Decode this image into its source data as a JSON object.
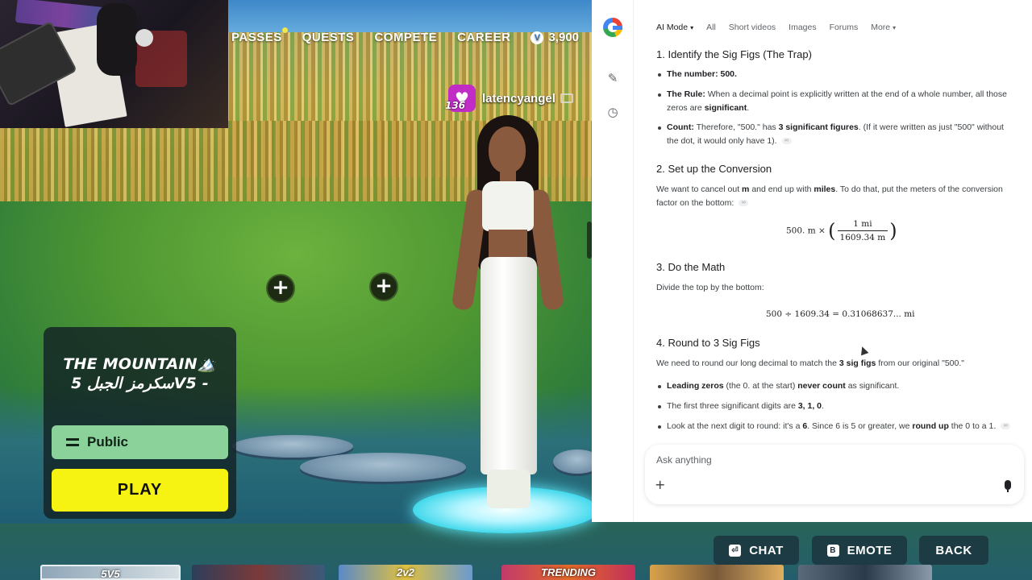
{
  "game": {
    "nav": [
      {
        "label": "PASSES",
        "dot": true
      },
      {
        "label": "QUESTS"
      },
      {
        "label": "COMPETE"
      },
      {
        "label": "CAREER"
      }
    ],
    "vbucks": "3,900",
    "vbucks_icon": "vbucks-icon",
    "player": {
      "level": "136",
      "name": "latencyangel"
    },
    "mode": {
      "title_line1": "THE MOUNTAIN🏔️",
      "title_line2": "سكرمز الجبل 5V5 -",
      "privacy": "Public",
      "play": "PLAY"
    },
    "bottom_buttons": {
      "chat_key": "⏎",
      "chat": "CHAT",
      "emote_key": "B",
      "emote": "EMOTE",
      "back": "BACK"
    },
    "tiles": [
      {
        "label": "5V5"
      },
      {
        "label": ""
      },
      {
        "label": "2v2"
      },
      {
        "label": "TRENDING"
      },
      {
        "label": ""
      },
      {
        "label": ""
      }
    ],
    "colors": {
      "play": "#f6f313",
      "public": "#8bd19a",
      "heart_badge": "#c12cc6"
    }
  },
  "browser": {
    "tabs": [
      "AI Mode",
      "All",
      "Short videos",
      "Images",
      "Forums",
      "More"
    ],
    "step1": {
      "heading": "1. Identify the Sig Figs (The Trap)",
      "b1_strong": "The number: 500.",
      "b2_strong": "The Rule:",
      "b2_text": "When a decimal point is explicitly written at the end of a whole number, all those zeros are",
      "b2_strong2": "significant",
      "b3_strong": "Count:",
      "b3_text": "Therefore, \"500.\" has",
      "b3_strong2": "3 significant figures",
      "b3_text2": ". (If it were written as just \"500\" without the dot, it would only have 1)."
    },
    "step2": {
      "heading": "2. Set up the Conversion",
      "text1": "We want to cancel out",
      "strong1": "m",
      "text2": "and end up with",
      "strong2": "miles",
      "text3": ". To do that, put the meters of the conversion factor on the bottom:",
      "math_lead": "500. m ×",
      "frac_num": "1 mi",
      "frac_den": "1609.34 m"
    },
    "step3": {
      "heading": "3. Do the Math",
      "text": "Divide the top by the bottom:",
      "math": "500 ÷ 1609.34 = 0.31068637... mi"
    },
    "step4": {
      "heading": "4. Round to 3 Sig Figs",
      "text1": "We need to round our long decimal to match the",
      "strong1": "3 sig figs",
      "text2": "from our original \"500.\"",
      "b1_strong": "Leading zeros",
      "b1_text": "(the 0. at the start)",
      "b1_strong2": "never count",
      "b1_text2": "as significant.",
      "b2_text": "The first three significant digits are",
      "b2_strong": "3, 1, 0",
      "b3_text": "Look at the next digit to round: it's a",
      "b3_strong": "6",
      "b3_text2": ". Since 6 is 5 or greater, we",
      "b3_strong2": "round up",
      "b3_text3": "the 0 to a 1."
    },
    "ask_placeholder": "Ask anything",
    "sidebar_icons": [
      "google-logo-icon",
      "edit-icon",
      "history-icon"
    ]
  }
}
